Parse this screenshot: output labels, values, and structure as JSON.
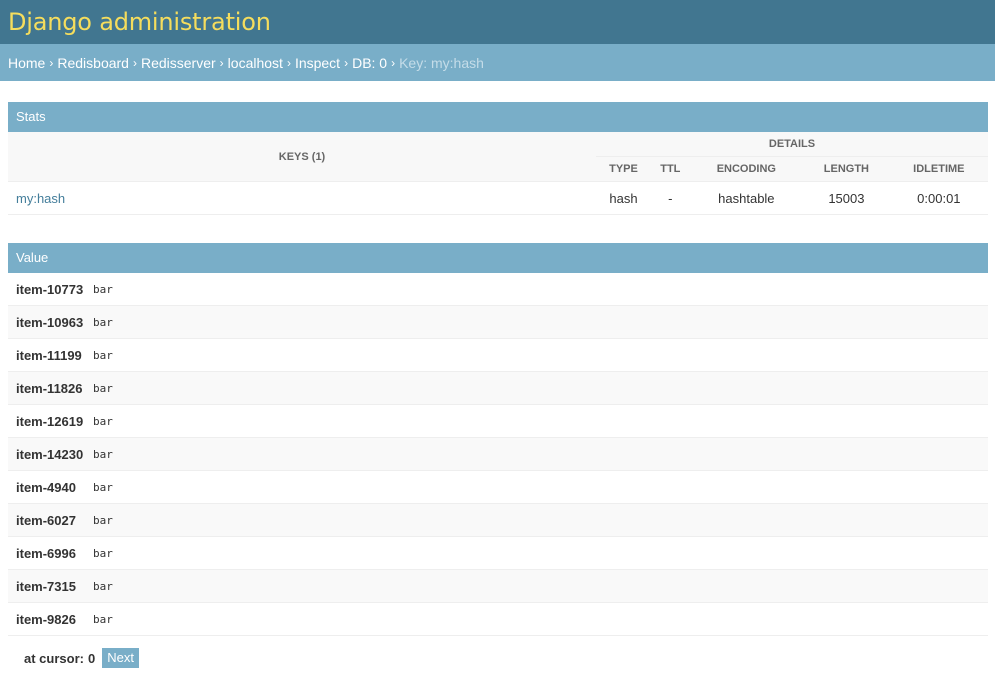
{
  "header": {
    "site_name": "Django administration"
  },
  "breadcrumbs": {
    "items": [
      "Home",
      "Redisboard",
      "Redisserver",
      "localhost",
      "Inspect",
      "DB: 0"
    ],
    "separator": "›",
    "current": "Key: my:hash"
  },
  "stats": {
    "caption": "Stats",
    "keys_header": "KEYS (1)",
    "details_header": "DETAILS",
    "columns": [
      "TYPE",
      "TTL",
      "ENCODING",
      "LENGTH",
      "IDLETIME"
    ],
    "row": {
      "key": "my:hash",
      "type": "hash",
      "ttl": "-",
      "encoding": "hashtable",
      "length": "15003",
      "idletime": "0:00:01"
    }
  },
  "value": {
    "caption": "Value",
    "rows": [
      {
        "field": "item-10773",
        "value": "bar"
      },
      {
        "field": "item-10963",
        "value": "bar"
      },
      {
        "field": "item-11199",
        "value": "bar"
      },
      {
        "field": "item-11826",
        "value": "bar"
      },
      {
        "field": "item-12619",
        "value": "bar"
      },
      {
        "field": "item-14230",
        "value": "bar"
      },
      {
        "field": "item-4940",
        "value": "bar"
      },
      {
        "field": "item-6027",
        "value": "bar"
      },
      {
        "field": "item-6996",
        "value": "bar"
      },
      {
        "field": "item-7315",
        "value": "bar"
      },
      {
        "field": "item-9826",
        "value": "bar"
      }
    ]
  },
  "pager": {
    "cursor_label": "at cursor:",
    "cursor_value": "0",
    "next_label": "Next"
  },
  "colors": {
    "header_bg": "#417690",
    "site_name": "#f5dd5d",
    "breadcrumbs_bg": "#79aec8",
    "caption_bg": "#79aec8",
    "link": "#447e9b"
  }
}
